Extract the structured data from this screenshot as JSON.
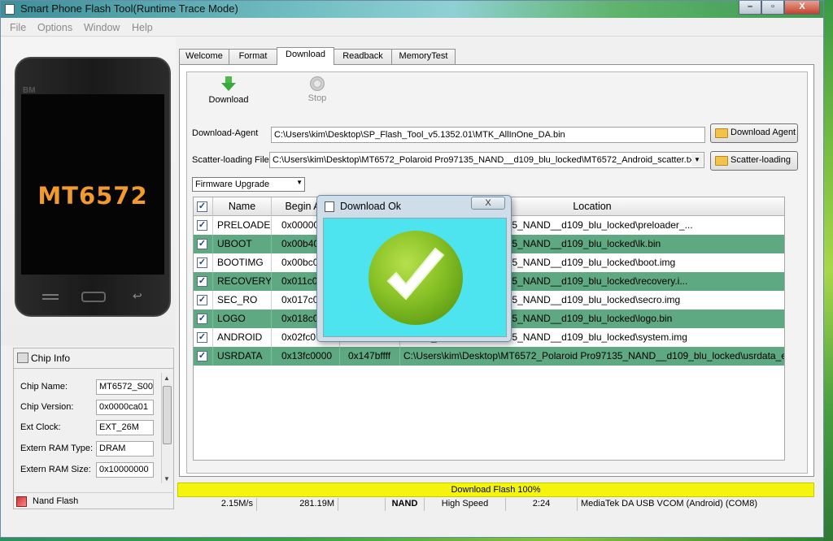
{
  "window": {
    "title": "Smart Phone Flash Tool(Runtime Trace Mode)",
    "controls": {
      "minimize": "–",
      "maximize": "▫",
      "close": "X"
    }
  },
  "menu": [
    "File",
    "Options",
    "Window",
    "Help"
  ],
  "phone": {
    "brand": "BM",
    "chip_label": "MT6572"
  },
  "chip_info": {
    "title": "Chip Info",
    "rows": [
      {
        "label": "Chip Name:",
        "value": "MT6572_S00"
      },
      {
        "label": "Chip Version:",
        "value": "0x0000ca01"
      },
      {
        "label": "Ext Clock:",
        "value": "EXT_26M"
      },
      {
        "label": "Extern RAM Type:",
        "value": "DRAM"
      },
      {
        "label": "Extern RAM Size:",
        "value": "0x10000000"
      }
    ]
  },
  "nand_flash": {
    "label": "Nand Flash"
  },
  "tabs": [
    "Welcome",
    "Format",
    "Download",
    "Readback",
    "MemoryTest"
  ],
  "active_tab": "Download",
  "toolbar": {
    "download_label": "Download",
    "stop_label": "Stop"
  },
  "download_agent": {
    "label": "Download-Agent",
    "value": "C:\\Users\\kim\\Desktop\\SP_Flash_Tool_v5.1352.01\\MTK_AllInOne_DA.bin",
    "button": "Download Agent"
  },
  "scatter": {
    "label": "Scatter-loading File",
    "value": "C:\\Users\\kim\\Desktop\\MT6572_Polaroid Pro97135_NAND__d109_blu_locked\\MT6572_Android_scatter.txt",
    "button": "Scatter-loading"
  },
  "mode_select": {
    "value": "Firmware Upgrade"
  },
  "table": {
    "headers": {
      "name": "Name",
      "begin": "Begin Ad",
      "location": "Location"
    },
    "rows": [
      {
        "name": "PRELOADER",
        "begin": "0x000000",
        "end": "",
        "location": "T6572_Polaroid Pro97135_NAND__d109_blu_locked\\preloader_...",
        "highlight": false
      },
      {
        "name": "UBOOT",
        "begin": "0x00b40",
        "end": "",
        "location": "T6572_Polaroid Pro97135_NAND__d109_blu_locked\\lk.bin",
        "highlight": true
      },
      {
        "name": "BOOTIMG",
        "begin": "0x00bc0",
        "end": "",
        "location": "T6572_Polaroid Pro97135_NAND__d109_blu_locked\\boot.img",
        "highlight": false
      },
      {
        "name": "RECOVERY",
        "begin": "0x011c0",
        "end": "",
        "location": "T6572_Polaroid Pro97135_NAND__d109_blu_locked\\recovery.i...",
        "highlight": true
      },
      {
        "name": "SEC_RO",
        "begin": "0x017c0",
        "end": "",
        "location": "T6572_Polaroid Pro97135_NAND__d109_blu_locked\\secro.img",
        "highlight": false
      },
      {
        "name": "LOGO",
        "begin": "0x018c0",
        "end": "",
        "location": "T6572_Polaroid Pro97135_NAND__d109_blu_locked\\logo.bin",
        "highlight": true
      },
      {
        "name": "ANDROID",
        "begin": "0x02fc0",
        "end": "",
        "location": "T6572_Polaroid Pro97135_NAND__d109_blu_locked\\system.img",
        "highlight": false
      },
      {
        "name": "USRDATA",
        "begin": "0x13fc0000",
        "end": "0x147bffff",
        "location": "C:\\Users\\kim\\Desktop\\MT6572_Polaroid Pro97135_NAND__d109_blu_locked\\usrdata_e...",
        "highlight": true
      }
    ]
  },
  "dialog": {
    "title": "Download Ok",
    "close": "X"
  },
  "progress": {
    "text": "Download Flash 100%",
    "percent": 100
  },
  "status": {
    "speed": "2.15M/s",
    "size": "281.19M",
    "storage": "NAND",
    "usb_speed": "High Speed",
    "time": "2:24",
    "port": "MediaTek DA USB VCOM (Android) (COM8)"
  },
  "colors": {
    "highlight_row": "#5ea882",
    "progress": "#f4f40c",
    "dialog_body": "#4de4ef",
    "chip_text": "#f29a2e"
  }
}
